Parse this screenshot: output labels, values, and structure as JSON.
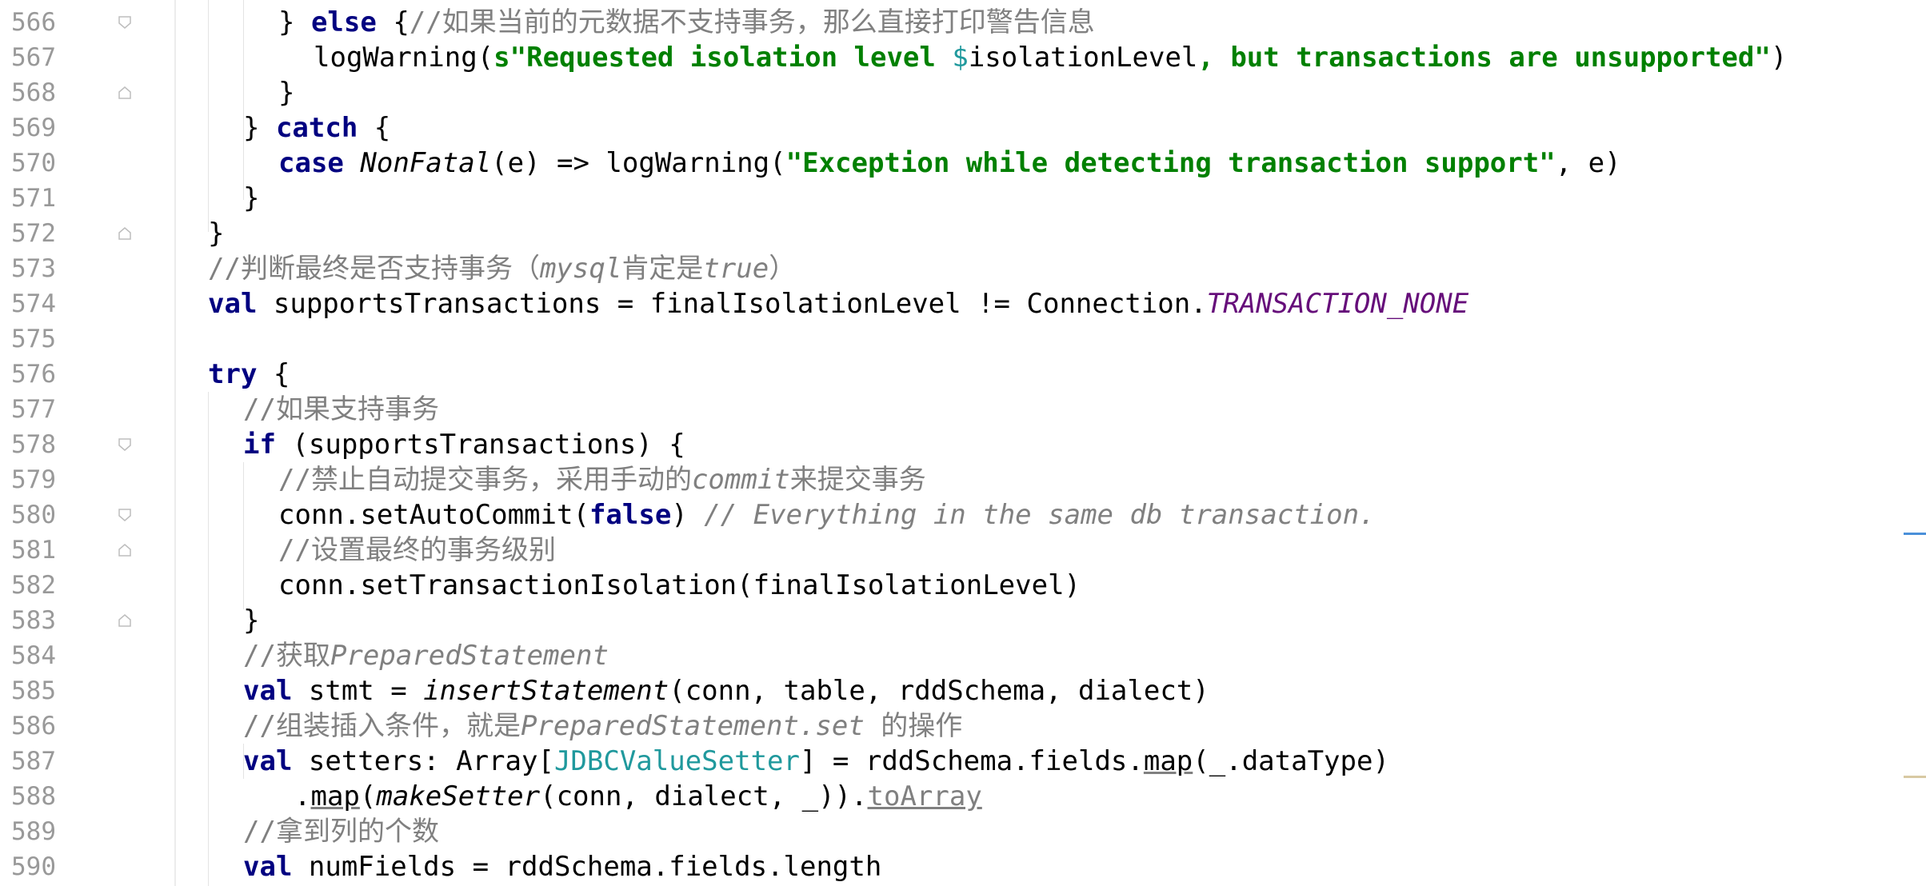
{
  "editor": {
    "line_numbers": [
      "566",
      "567",
      "568",
      "569",
      "570",
      "571",
      "572",
      "573",
      "574",
      "575",
      "576",
      "577",
      "578",
      "579",
      "580",
      "581",
      "582",
      "583",
      "584",
      "585",
      "586",
      "587",
      "588",
      "589",
      "590"
    ],
    "lines": {
      "l566": {
        "brace_else": "} ",
        "else": "else",
        "open": " {",
        "comment": "//如果当前的元数据不支持事务，那么直接打印警告信息"
      },
      "l567": {
        "call": "logWarning(",
        "s_prefix": "s\"Requested isolation level ",
        "dollar": "$",
        "var": "isolationLevel",
        "rest": ", but transactions are unsupported\"",
        "close": ")"
      },
      "l568": {
        "text": "}"
      },
      "l569": {
        "brace": "} ",
        "catch": "catch",
        "open": " {"
      },
      "l570": {
        "case": "case",
        "space": " ",
        "nonfatal": "NonFatal",
        "mid": "(e) => logWarning(",
        "str": "\"Exception while detecting transaction support\"",
        "end": ", e)"
      },
      "l571": {
        "text": "}"
      },
      "l572": {
        "text": "}"
      },
      "l573": {
        "c1": "//判断最终是否支持事务（",
        "c2": "mysql",
        "c3": "肯定是",
        "c4": "true",
        "c5": "）"
      },
      "l574": {
        "val": "val",
        "mid": " supportsTransactions = finalIsolationLevel != Connection.",
        "const": "TRANSACTION_NONE"
      },
      "l575": {
        "text": ""
      },
      "l576": {
        "try": "try",
        "open": " {"
      },
      "l577": {
        "comment": "//如果支持事务"
      },
      "l578": {
        "if": "if",
        "rest": " (supportsTransactions) {"
      },
      "l579": {
        "c1": "//禁止自动提交事务，采用手动的",
        "c2": "commit",
        "c3": "来提交事务"
      },
      "l580": {
        "pre": "conn.setAutoCommit(",
        "false": "false",
        "post": ") ",
        "comment": "// Everything in the same db transaction."
      },
      "l581": {
        "comment": "//设置最终的事务级别"
      },
      "l582": {
        "text": "conn.setTransactionIsolation(finalIsolationLevel)"
      },
      "l583": {
        "text": "}"
      },
      "l584": {
        "c1": "//获取",
        "c2": "PreparedStatement"
      },
      "l585": {
        "val": "val",
        "mid": " stmt = ",
        "fn": "insertStatement",
        "rest": "(conn, table, rddSchema, dialect)"
      },
      "l586": {
        "c1": "//组装插入条件，就是",
        "c2": "PreparedStatement.set",
        "c3": " 的操作"
      },
      "l587": {
        "val": "val",
        "mid": " setters: Array[",
        "type": "JDBCValueSetter",
        "mid2": "] = rddSchema.fields.",
        "map": "map",
        "rest": "(_.dataType)"
      },
      "l588": {
        "dot": ".",
        "map": "map",
        "paren": "(",
        "fn": "makeSetter",
        "rest": "(conn, dialect, _)).",
        "toarray": "toArray"
      },
      "l589": {
        "comment": "//拿到列的个数"
      },
      "l590": {
        "val": "val",
        "rest": " numFields = rddSchema.fields.length"
      }
    }
  }
}
